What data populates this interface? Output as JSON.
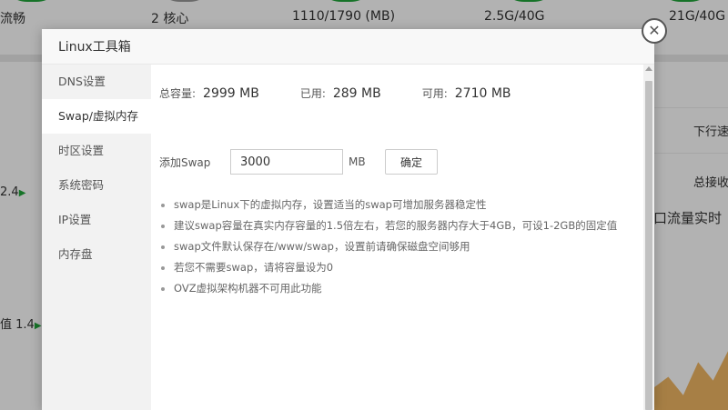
{
  "background": {
    "stats": [
      "流畅",
      "2 核心",
      "1110/1790 (MB)",
      "2.5G/40G",
      "21G/40G"
    ],
    "left_values": [
      "2.4",
      "值 1.4"
    ],
    "right_texts": [
      "下行速",
      "总接收",
      "口流量实时"
    ]
  },
  "modal": {
    "title": "Linux工具箱",
    "sidebar": [
      {
        "label": "DNS设置"
      },
      {
        "label": "Swap/虚拟内存",
        "active": true
      },
      {
        "label": "时区设置"
      },
      {
        "label": "系统密码"
      },
      {
        "label": "IP设置"
      },
      {
        "label": "内存盘"
      }
    ],
    "stats": {
      "total_label": "总容量:",
      "total_value": "2999 MB",
      "used_label": "已用:",
      "used_value": "289 MB",
      "free_label": "可用:",
      "free_value": "2710 MB"
    },
    "swap": {
      "label": "添加Swap",
      "value": "3000",
      "unit": "MB",
      "confirm": "确定"
    },
    "tips": [
      "swap是Linux下的虚拟内存，设置适当的swap可增加服务器稳定性",
      "建议swap容量在真实内存容量的1.5倍左右，若您的服务器内存大于4GB，可设1-2GB的固定值",
      "swap文件默认保存在/www/swap，设置前请确保磁盘空间够用",
      "若您不需要swap，请将容量设为0",
      "OVZ虚拟架构机器不可用此功能"
    ]
  },
  "icons": {
    "close": "close-icon",
    "scroll_up": "scroll-up-arrow-icon",
    "arrow": "triangle-right-icon"
  },
  "colors": {
    "accent": "#20a53a",
    "wave": "#f0b663"
  }
}
